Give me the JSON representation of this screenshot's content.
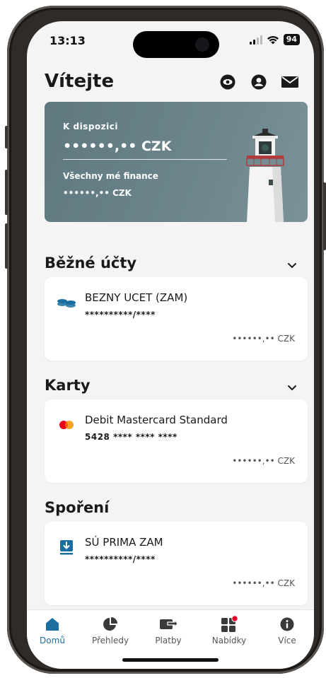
{
  "status_bar": {
    "time": "13:13",
    "battery": "94"
  },
  "header": {
    "title": "Vítejte"
  },
  "balance_card": {
    "available_label": "K dispozici",
    "available_amount": "••••••,•• CZK",
    "finances_label": "Všechny mé finance",
    "finances_amount": "••••••,•• CZK"
  },
  "sections": {
    "current_accounts": {
      "title": "Běžné účty",
      "item": {
        "name": "BEZNY UCET (ZAM)",
        "number": "**********/****",
        "balance": "••••••,•• CZK",
        "icon": "coins-icon"
      }
    },
    "cards": {
      "title": "Karty",
      "item": {
        "name": "Debit Mastercard Standard",
        "number": "5428 **** **** ****",
        "balance": "••••••,•• CZK",
        "icon": "mastercard-icon"
      }
    },
    "savings": {
      "title": "Spoření",
      "item": {
        "name": "SÚ PRIMA ZAM",
        "number": "**********/****",
        "balance": "••••••,•• CZK",
        "icon": "savings-download-icon"
      }
    }
  },
  "bottom_nav": {
    "items": [
      {
        "label": "Domů",
        "icon": "home-icon",
        "active": true
      },
      {
        "label": "Přehledy",
        "icon": "pie-chart-icon",
        "active": false
      },
      {
        "label": "Platby",
        "icon": "payments-icon",
        "active": false
      },
      {
        "label": "Nabídky",
        "icon": "offers-icon",
        "active": false,
        "badge": true
      },
      {
        "label": "Více",
        "icon": "info-icon",
        "active": false
      }
    ]
  },
  "colors": {
    "accent": "#1a6fa0",
    "card_bg": "#6d868d",
    "badge": "#e4002b"
  }
}
